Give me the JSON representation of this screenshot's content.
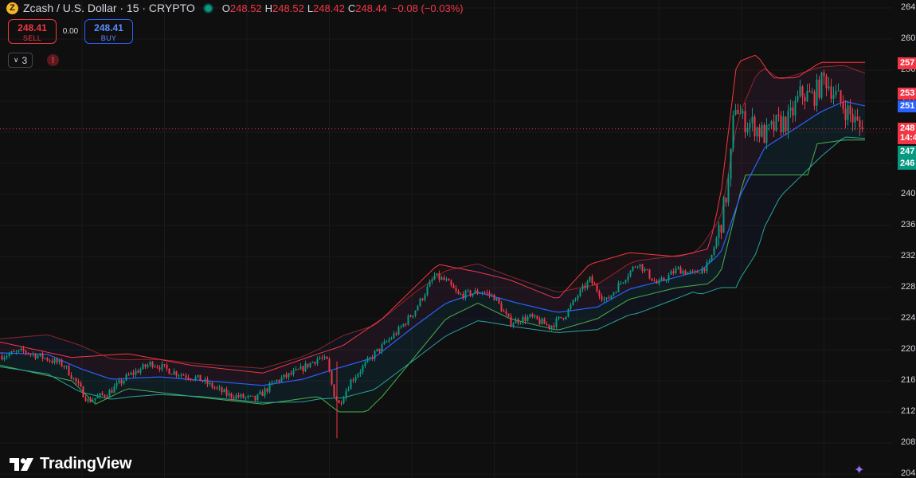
{
  "symbol": {
    "title": "Zcash / U.S. Dollar · 15 · CRYPTO",
    "icon": "zcash-coin-icon",
    "open_label": "O",
    "open": "248.52",
    "high_label": "H",
    "high": "248.52",
    "low_label": "L",
    "low": "248.42",
    "close_label": "C",
    "close": "248.44",
    "change": "−0.08 (−0.03%)"
  },
  "trade": {
    "sell_price": "248.41",
    "sell_label": "SELL",
    "spread": "0.00",
    "buy_price": "248.41",
    "buy_label": "BUY"
  },
  "indicators": {
    "count": "3",
    "warning_icon": "alert-icon"
  },
  "branding": {
    "name": "TradingView"
  },
  "price_scale": [
    "264",
    "260",
    "256",
    "252",
    "248",
    "244",
    "240",
    "236",
    "232",
    "228",
    "224",
    "220",
    "216",
    "212",
    "208",
    "204"
  ],
  "price_tags": [
    {
      "text": "257",
      "value": 256.9,
      "color": "#f23645"
    },
    {
      "text": "253",
      "value": 253.0,
      "color": "#f23645"
    },
    {
      "text": "251",
      "value": 251.3,
      "color": "#2962ff"
    },
    {
      "text": "248",
      "value": 248.44,
      "color": "#f23645"
    },
    {
      "text": "14:4",
      "value": 247.2,
      "color": "#f23645"
    },
    {
      "text": "247",
      "value": 245.5,
      "color": "#089981"
    },
    {
      "text": "246",
      "value": 243.9,
      "color": "#089981"
    }
  ],
  "colors": {
    "up": "#089981",
    "down": "#f23645",
    "upper_band": "#f23645",
    "lower_band": "#089981",
    "basis": "#2962ff",
    "background": "#0f0f0f"
  },
  "chart_data": {
    "type": "candlestick",
    "y_range": [
      204,
      264
    ],
    "last_price": 248.44,
    "anchors": [
      [
        0,
        219.2
      ],
      [
        30,
        219.8
      ],
      [
        60,
        218.8
      ],
      [
        80,
        218.0
      ],
      [
        95,
        215.8
      ],
      [
        110,
        213.4
      ],
      [
        135,
        214.4
      ],
      [
        160,
        216.6
      ],
      [
        190,
        218.3
      ],
      [
        215,
        217.2
      ],
      [
        250,
        216.2
      ],
      [
        285,
        214.2
      ],
      [
        320,
        213.6
      ],
      [
        345,
        215.9
      ],
      [
        375,
        217.3
      ],
      [
        400,
        219.0
      ],
      [
        410,
        218.5
      ],
      [
        418,
        214.5
      ],
      [
        425,
        213.0
      ],
      [
        440,
        216.0
      ],
      [
        470,
        219.5
      ],
      [
        500,
        222.5
      ],
      [
        520,
        225.0
      ],
      [
        545,
        229.5
      ],
      [
        560,
        228.8
      ],
      [
        575,
        227.0
      ],
      [
        605,
        227.5
      ],
      [
        620,
        226.8
      ],
      [
        640,
        223.5
      ],
      [
        665,
        224.2
      ],
      [
        690,
        223.0
      ],
      [
        710,
        224.6
      ],
      [
        725,
        227.0
      ],
      [
        740,
        229.0
      ],
      [
        760,
        226.2
      ],
      [
        780,
        228.8
      ],
      [
        800,
        231.2
      ],
      [
        825,
        228.4
      ],
      [
        850,
        230.4
      ],
      [
        870,
        229.7
      ],
      [
        890,
        231.0
      ],
      [
        905,
        236.5
      ],
      [
        915,
        242.0
      ],
      [
        922,
        252.0
      ],
      [
        932,
        249.5
      ],
      [
        945,
        249.0
      ],
      [
        960,
        247.5
      ],
      [
        975,
        249.0
      ],
      [
        990,
        249.5
      ],
      [
        1005,
        253.0
      ],
      [
        1020,
        252.5
      ],
      [
        1035,
        255.0
      ],
      [
        1050,
        252.5
      ],
      [
        1065,
        250.5
      ],
      [
        1080,
        248.4
      ]
    ],
    "basis_anchors": [
      [
        0,
        219.6
      ],
      [
        60,
        219.4
      ],
      [
        100,
        217.6
      ],
      [
        140,
        216.2
      ],
      [
        200,
        216.5
      ],
      [
        260,
        216.0
      ],
      [
        330,
        215.4
      ],
      [
        380,
        216.2
      ],
      [
        420,
        217.5
      ],
      [
        470,
        219.0
      ],
      [
        520,
        223.0
      ],
      [
        560,
        226.0
      ],
      [
        600,
        227.4
      ],
      [
        650,
        226.0
      ],
      [
        700,
        224.8
      ],
      [
        750,
        225.5
      ],
      [
        790,
        227.8
      ],
      [
        840,
        229.1
      ],
      [
        880,
        230.2
      ],
      [
        905,
        232.5
      ],
      [
        930,
        240.0
      ],
      [
        960,
        246.0
      ],
      [
        1000,
        248.6
      ],
      [
        1030,
        250.6
      ],
      [
        1060,
        252.0
      ],
      [
        1085,
        251.4
      ]
    ],
    "band_half_width_anchors": [
      [
        0,
        1.8
      ],
      [
        100,
        3.0
      ],
      [
        160,
        2.4
      ],
      [
        250,
        2.1
      ],
      [
        330,
        2.2
      ],
      [
        400,
        3.2
      ],
      [
        430,
        4.0
      ],
      [
        520,
        4.3
      ],
      [
        560,
        4.2
      ],
      [
        620,
        3.4
      ],
      [
        700,
        2.6
      ],
      [
        750,
        2.9
      ],
      [
        800,
        3.4
      ],
      [
        870,
        2.5
      ],
      [
        905,
        4.5
      ],
      [
        925,
        10.5
      ],
      [
        950,
        11.5
      ],
      [
        980,
        7.5
      ],
      [
        1030,
        5.8
      ],
      [
        1060,
        4.6
      ],
      [
        1085,
        4.2
      ]
    ],
    "box_high_anchors": [
      [
        0,
        221.0
      ],
      [
        90,
        219.0
      ],
      [
        160,
        219.5
      ],
      [
        240,
        218.0
      ],
      [
        330,
        217.0
      ],
      [
        400,
        219.5
      ],
      [
        430,
        220.5
      ],
      [
        480,
        224.0
      ],
      [
        520,
        228.0
      ],
      [
        550,
        231.0
      ],
      [
        600,
        230.0
      ],
      [
        640,
        229.0
      ],
      [
        700,
        226.5
      ],
      [
        740,
        231.0
      ],
      [
        790,
        232.5
      ],
      [
        850,
        232.0
      ],
      [
        890,
        233.0
      ],
      [
        905,
        240.0
      ],
      [
        925,
        257.0
      ],
      [
        950,
        258.0
      ],
      [
        970,
        255.0
      ],
      [
        1000,
        255.0
      ],
      [
        1030,
        257.0
      ],
      [
        1085,
        257.0
      ]
    ],
    "box_low_anchors": [
      [
        0,
        218.0
      ],
      [
        90,
        216.0
      ],
      [
        120,
        213.0
      ],
      [
        160,
        215.0
      ],
      [
        240,
        214.0
      ],
      [
        330,
        213.0
      ],
      [
        400,
        214.0
      ],
      [
        425,
        212.0
      ],
      [
        460,
        212.0
      ],
      [
        480,
        214.0
      ],
      [
        520,
        219.0
      ],
      [
        560,
        224.0
      ],
      [
        600,
        226.0
      ],
      [
        640,
        224.0
      ],
      [
        700,
        222.5
      ],
      [
        750,
        224.0
      ],
      [
        790,
        226.5
      ],
      [
        850,
        228.0
      ],
      [
        890,
        228.5
      ],
      [
        905,
        230.0
      ],
      [
        935,
        242.5
      ],
      [
        970,
        242.5
      ],
      [
        1000,
        242.5
      ],
      [
        1015,
        242.5
      ],
      [
        1025,
        246.5
      ],
      [
        1060,
        247.0
      ],
      [
        1085,
        247.0
      ]
    ]
  }
}
